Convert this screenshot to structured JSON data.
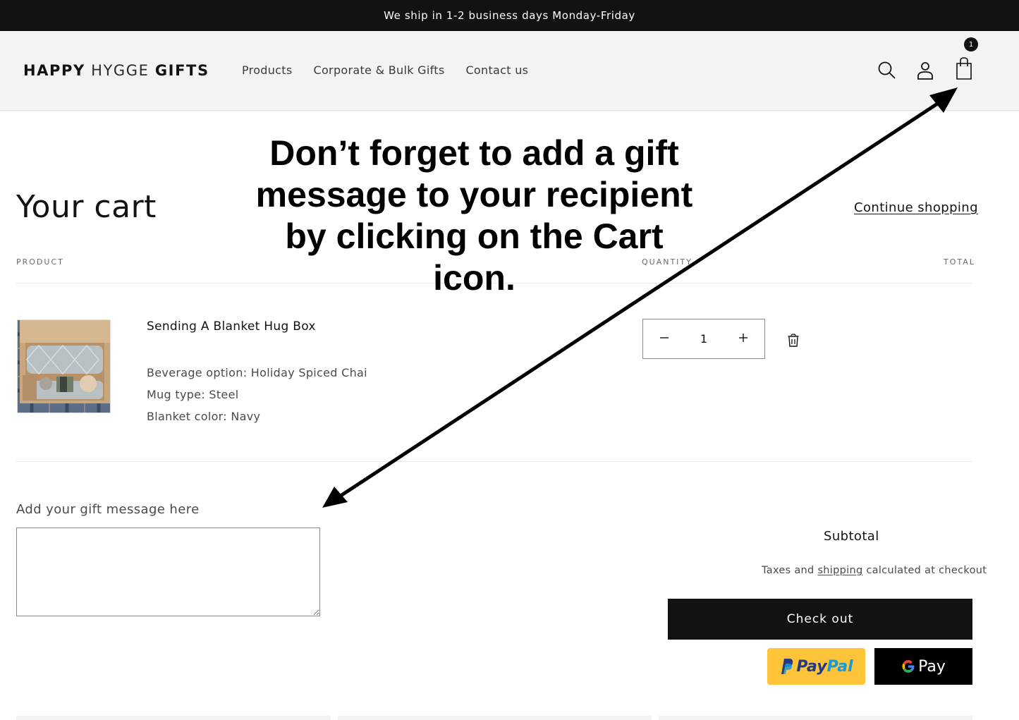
{
  "announcement": "We ship in 1-2 business days Monday-Friday",
  "header": {
    "logo": {
      "part1": "HAPPY",
      "part2": "HYGGE",
      "part3": "GIFTS"
    },
    "nav": [
      "Products",
      "Corporate & Bulk Gifts",
      "Contact us"
    ],
    "icons": [
      "search-icon",
      "account-icon",
      "cart-icon"
    ],
    "cart_count": "1"
  },
  "cart": {
    "title": "Your cart",
    "continue_shopping": "Continue shopping",
    "columns": {
      "product": "PRODUCT",
      "quantity": "QUANTITY",
      "total": "TOTAL"
    },
    "items": [
      {
        "name": "Sending A Blanket Hug Box",
        "options": [
          "Beverage option: Holiday Spiced Chai",
          "Mug type: Steel",
          "Blanket color: Navy"
        ],
        "quantity": "1"
      }
    ],
    "gift_message": {
      "label": "Add your gift message here",
      "value": ""
    },
    "subtotal_label": "Subtotal",
    "taxes_note": {
      "before": "Taxes and ",
      "link": "shipping",
      "after": " calculated at checkout"
    },
    "checkout_label": "Check out",
    "paypal": {
      "part1": "Pay",
      "part2": "Pal"
    },
    "gpay_label": "Pay"
  },
  "annotation": {
    "lines": [
      "Don’t forget to add a gift",
      "message to your recipient",
      "by clicking on the Cart",
      "icon."
    ]
  },
  "colors": {
    "dark": "#121212",
    "header_bg": "#f3f3f3",
    "paypal_yellow": "#ffc439",
    "paypal_navy": "#253b80",
    "paypal_blue": "#179bd7"
  }
}
